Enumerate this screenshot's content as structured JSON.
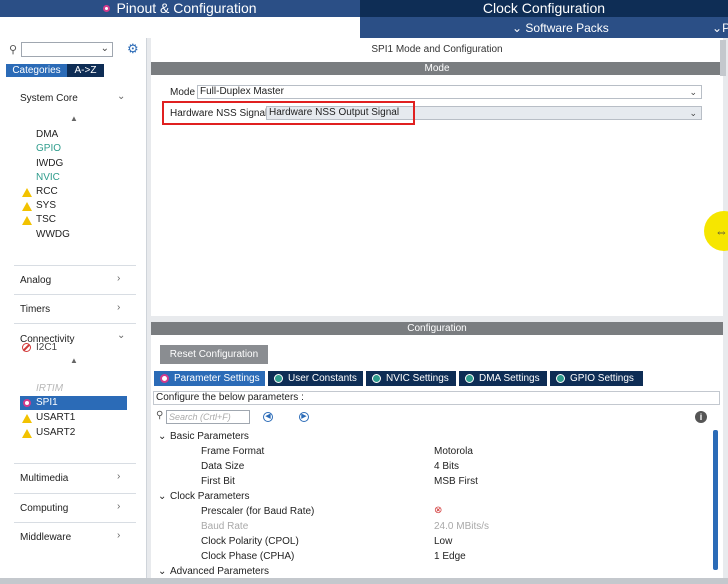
{
  "header": {
    "pinout_tab": "Pinout & Configuration",
    "clock_tab": "Clock Configuration",
    "software_packs": "Software Packs",
    "right_cut": "P"
  },
  "left": {
    "search_placeholder": "",
    "tab_categories": "Categories",
    "tab_az": "A->Z",
    "system_core": "System Core",
    "system_items": [
      "DMA",
      "GPIO",
      "IWDG",
      "NVIC",
      "RCC",
      "SYS",
      "TSC",
      "WWDG"
    ],
    "analog": "Analog",
    "timers": "Timers",
    "connectivity": "Connectivity",
    "conn_items": [
      "I2C1",
      "IRTIM",
      "SPI1",
      "USART1",
      "USART2"
    ],
    "multimedia": "Multimedia",
    "computing": "Computing",
    "middleware": "Middleware"
  },
  "mode": {
    "title": "SPI1 Mode and Configuration",
    "section": "Mode",
    "mode_label": "Mode",
    "mode_value": "Full-Duplex Master",
    "nss_label": "Hardware NSS Signal",
    "nss_value": "Hardware NSS Output Signal"
  },
  "config": {
    "section": "Configuration",
    "reset_button": "Reset Configuration",
    "tabs": [
      "Parameter Settings",
      "User Constants",
      "NVIC Settings",
      "DMA Settings",
      "GPIO Settings"
    ],
    "configure_text": "Configure the below parameters :",
    "search_placeholder": "Search (Crtl+F)",
    "groups": {
      "basic": "Basic Parameters",
      "clock": "Clock Parameters",
      "advanced": "Advanced Parameters"
    },
    "params": [
      {
        "name": "Frame Format",
        "value": "Motorola"
      },
      {
        "name": "Data Size",
        "value": "4 Bits"
      },
      {
        "name": "First Bit",
        "value": "MSB First"
      },
      {
        "name": "Prescaler (for Baud Rate)",
        "value": ""
      },
      {
        "name": "Baud Rate",
        "value": "24.0 MBits/s"
      },
      {
        "name": "Clock Polarity (CPOL)",
        "value": "Low"
      },
      {
        "name": "Clock Phase (CPHA)",
        "value": "1 Edge"
      }
    ]
  },
  "colors": {
    "navy": "#0e2d55",
    "blue": "#2b4f86",
    "accent": "#2b6bb7",
    "warning": "#f2c200",
    "error": "#d23a3a",
    "highlight_box": "#e02020"
  }
}
